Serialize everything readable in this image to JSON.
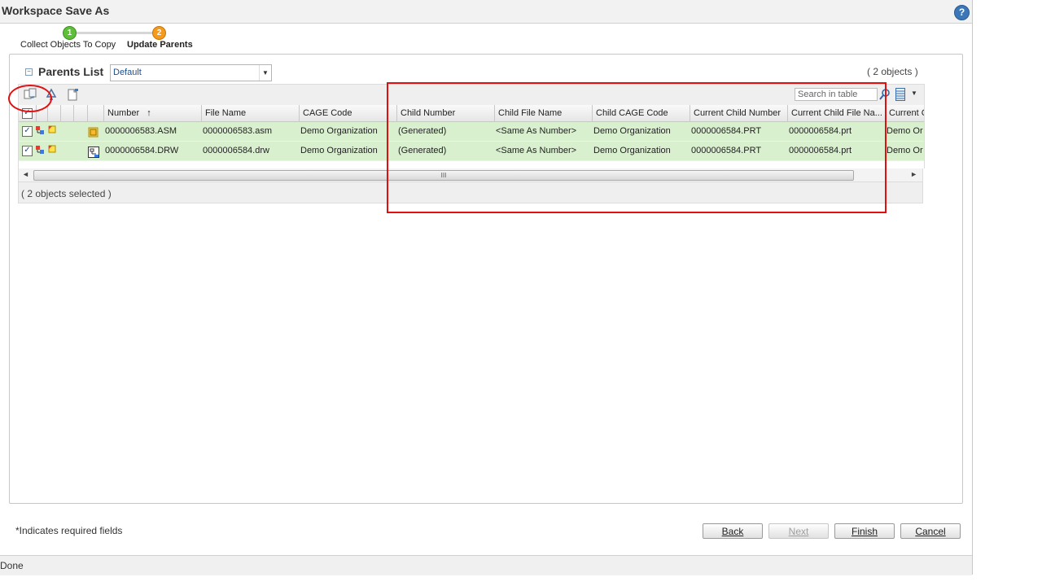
{
  "window": {
    "title": "Workspace Save As",
    "help_icon": "help-icon",
    "help_glyph": "?"
  },
  "wizard": {
    "steps": [
      {
        "number": "1",
        "label": "Collect Objects To Copy",
        "color": "#5fbf3a"
      },
      {
        "number": "2",
        "label": "Update Parents",
        "color": "#f39a1f",
        "current": true
      }
    ]
  },
  "parents_list": {
    "title": "Parents List",
    "view_select": "Default",
    "object_count": "( 2 objects )",
    "search_placeholder": "Search in table",
    "toolbar_icons": [
      "replace-icon",
      "recycle-icon",
      "new-document-icon"
    ],
    "columns": [
      "Number",
      "File Name",
      "CAGE Code",
      "Child Number",
      "Child File Name",
      "Child CAGE Code",
      "Current Child Number",
      "Current Child File Na...",
      "Current C"
    ],
    "sort_indicator": "↑",
    "rows": [
      {
        "number": "0000006583.ASM",
        "file_name": "0000006583.asm",
        "cage_code": "Demo Organization",
        "child_number": "(Generated)",
        "child_file_name": "<Same As Number>",
        "child_cage_code": "Demo Organization",
        "current_child_number": "0000006584.PRT",
        "current_child_file_name": "0000006584.prt",
        "current_c": "Demo Or",
        "type_icon": "assembly-icon",
        "checked": true
      },
      {
        "number": "0000006584.DRW",
        "file_name": "0000006584.drw",
        "cage_code": "Demo Organization",
        "child_number": "(Generated)",
        "child_file_name": "<Same As Number>",
        "child_cage_code": "Demo Organization",
        "current_child_number": "0000006584.PRT",
        "current_child_file_name": "0000006584.prt",
        "current_c": "Demo Or",
        "type_icon": "drawing-icon",
        "checked": true
      }
    ],
    "scroll_grip": "III",
    "selected_text": "( 2 objects selected )"
  },
  "footer": {
    "required_note": "*Indicates required fields",
    "buttons": {
      "back": "Back",
      "next": "Next",
      "finish": "Finish",
      "cancel": "Cancel"
    }
  },
  "status_bar": {
    "text": "Done"
  },
  "colors": {
    "row_bg": "#d9f0cf",
    "highlight": "#e01010",
    "accent": "#1b4f8f"
  }
}
